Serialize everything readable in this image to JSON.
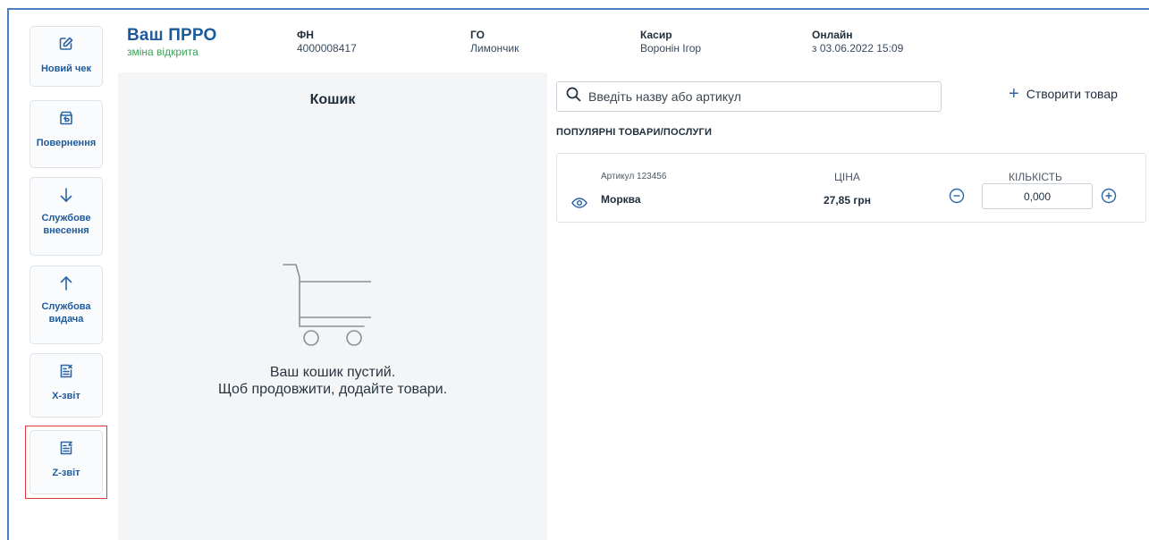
{
  "sidebar": {
    "items": [
      {
        "label": "Новий чек",
        "icon": "edit-icon"
      },
      {
        "label": "Повернення",
        "icon": "return-box-icon"
      },
      {
        "label": "Службове внесення",
        "icon": "arrow-down-icon"
      },
      {
        "label": "Службова видача",
        "icon": "arrow-up-icon"
      },
      {
        "label": "X-звіт",
        "icon": "x-report-icon"
      },
      {
        "label": "Z-звіт",
        "icon": "z-report-icon"
      }
    ]
  },
  "header": {
    "brand": {
      "title": "Ваш ПРРО",
      "status": "зміна відкрита"
    },
    "fn": {
      "label": "ФН",
      "value": "4000008417"
    },
    "go": {
      "label": "ГО",
      "value": "Лимончик"
    },
    "cashier": {
      "label": "Касир",
      "value": "Воронін Ігор"
    },
    "online": {
      "label": "Онлайн",
      "value": "з 03.06.2022 15:09"
    }
  },
  "cart": {
    "title": "Кошик",
    "empty_line1": "Ваш кошик пустий.",
    "empty_line2": "Щоб продовжити, додайте товари."
  },
  "search": {
    "placeholder": "Введіть назву або артикул",
    "value": ""
  },
  "create_product_label": "Створити товар",
  "popular_title": "ПОПУЛЯРНІ ТОВАРИ/ПОСЛУГИ",
  "products": [
    {
      "article": "Артикул 123456",
      "name": "Морква",
      "price_label": "ЦІНА",
      "price": "27,85 грн",
      "qty_label": "КІЛЬКІСТЬ",
      "qty": "0,000"
    }
  ],
  "colors": {
    "accent": "#1d5a9c",
    "status_open": "#3ea05a",
    "highlight": "#e33a3a",
    "cart_bg": "#f4f5f7"
  }
}
